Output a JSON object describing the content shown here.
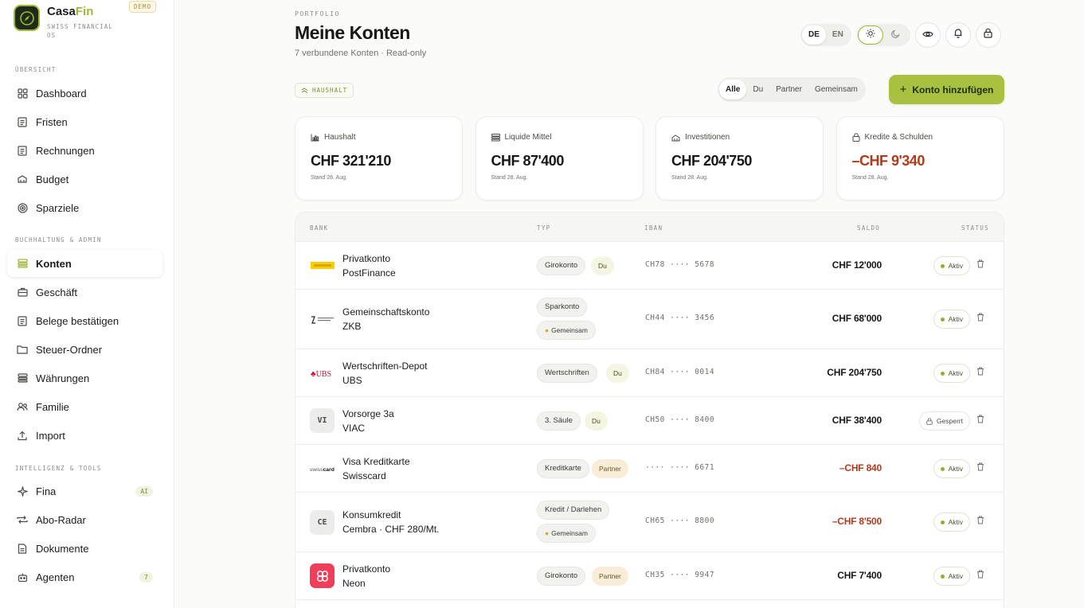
{
  "brand": {
    "name_main": "Casa",
    "name_accent": "Fin",
    "subtitle": "SWISS FINANCIAL OS",
    "badge": "DEMO"
  },
  "sidebar": {
    "sections": [
      "ÜBERSICHT",
      "BUCHHALTUNG & ADMIN",
      "INTELLIGENZ & TOOLS"
    ],
    "items": [
      {
        "label": "Dashboard",
        "icon": "grid-icon"
      },
      {
        "label": "Fristen",
        "icon": "calendar-icon"
      },
      {
        "label": "Rechnungen",
        "icon": "invoice-icon"
      },
      {
        "label": "Budget",
        "icon": "piggy-bank-icon"
      },
      {
        "label": "Sparziele",
        "icon": "target-icon"
      },
      {
        "label": "Konten",
        "icon": "bank-icon"
      },
      {
        "label": "Geschäft",
        "icon": "briefcase-icon"
      },
      {
        "label": "Belege bestätigen",
        "icon": "receipt-icon"
      },
      {
        "label": "Steuer-Ordner",
        "icon": "folder-icon"
      },
      {
        "label": "Währungen",
        "icon": "currency-icon"
      },
      {
        "label": "Familie",
        "icon": "family-icon"
      },
      {
        "label": "Import",
        "icon": "upload-icon"
      },
      {
        "label": "Fina",
        "icon": "sparkle-icon",
        "badge": "AI"
      },
      {
        "label": "Abo-Radar",
        "icon": "repeat-icon"
      },
      {
        "label": "Dokumente",
        "icon": "document-icon"
      },
      {
        "label": "Agenten",
        "icon": "robot-icon",
        "badge": "7"
      }
    ]
  },
  "header": {
    "eyebrow": "PORTFOLIO",
    "title": "Meine Konten",
    "subtitle": "7 verbundene Konten · Read-only",
    "lang": [
      "DE",
      "EN"
    ],
    "lang_active": "DE"
  },
  "toolbar": {
    "tag": "HAUSHALT",
    "filters": [
      "Alle",
      "Du",
      "Partner",
      "Gemeinsam"
    ],
    "filter_active": "Alle",
    "add_label": "Konto hinzufügen"
  },
  "cards": [
    {
      "label": "Haushalt",
      "value": "CHF 321'210",
      "date": "Stand 28. Aug.",
      "negative": false,
      "icon": "chart-icon"
    },
    {
      "label": "Liquide Mittel",
      "value": "CHF 87'400",
      "date": "Stand 28. Aug.",
      "negative": false,
      "icon": "wallet-icon"
    },
    {
      "label": "Investitionen",
      "value": "CHF 204'750",
      "date": "Stand 28. Aug.",
      "negative": false,
      "icon": "trend-icon"
    },
    {
      "label": "Kredite & Schulden",
      "value": "–CHF 9'340",
      "date": "Stand 28. Aug.",
      "negative": true,
      "icon": "lock-icon"
    }
  ],
  "table": {
    "headers": {
      "bank": "BANK",
      "type": "TYP",
      "iban": "IBAN",
      "saldo": "SALDO",
      "status": "STATUS"
    },
    "rows": [
      {
        "name": "Privatkonto",
        "bank": "PostFinance",
        "logo": "postfinance",
        "type": "Girokonto",
        "owner": "Du",
        "iban": "CH78 ···· 5678",
        "saldo": "CHF 12'000",
        "negative": false,
        "status": "Aktiv"
      },
      {
        "name": "Gemeinschaftskonto",
        "bank": "ZKB",
        "logo": "zkb",
        "type": "Sparkonto",
        "owner": "Gemeinsam",
        "iban": "CH44 ···· 3456",
        "saldo": "CHF 68'000",
        "negative": false,
        "status": "Aktiv"
      },
      {
        "name": "Wertschriften-Depot",
        "bank": "UBS",
        "logo": "ubs",
        "type": "Wertschriften",
        "owner": "Du",
        "iban": "CH84 ···· 0014",
        "saldo": "CHF 204'750",
        "negative": false,
        "status": "Aktiv"
      },
      {
        "name": "Vorsorge 3a",
        "bank": "VIAC",
        "logo": "VI",
        "type": "3. Säule",
        "owner": "Du",
        "iban": "CH50 ···· 8400",
        "saldo": "CHF 38'400",
        "negative": false,
        "status": "Gesperrt"
      },
      {
        "name": "Visa Kreditkarte",
        "bank": "Swisscard",
        "logo": "swisscard",
        "type": "Kreditkarte",
        "owner": "Partner",
        "iban": "···· ···· 6671",
        "saldo": "–CHF 840",
        "negative": true,
        "status": "Aktiv"
      },
      {
        "name": "Konsumkredit",
        "bank": "Cembra · CHF 280/Mt.",
        "logo": "CE",
        "type": "Kredit / Darlehen",
        "owner": "Gemeinsam",
        "iban": "CH65 ···· 8800",
        "saldo": "–CHF 8'500",
        "negative": true,
        "status": "Aktiv"
      },
      {
        "name": "Privatkonto",
        "bank": "Neon",
        "logo": "neon",
        "type": "Girokonto",
        "owner": "Partner",
        "iban": "CH35 ···· 9947",
        "saldo": "CHF 7'400",
        "negative": false,
        "status": "Aktiv"
      }
    ]
  },
  "colors": {
    "accent": "#a8c23f",
    "negative": "#b23a1c",
    "active_dot": "#8fb02a"
  }
}
